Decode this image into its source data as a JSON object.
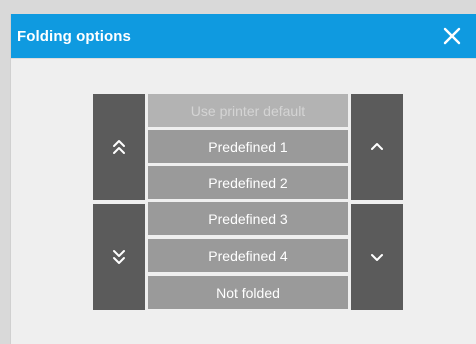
{
  "dialog": {
    "title": "Folding options",
    "close_icon": "close-icon"
  },
  "options": [
    {
      "label": "Use printer default",
      "state": "disabled"
    },
    {
      "label": "Predefined 1",
      "state": "enabled"
    },
    {
      "label": "Predefined 2",
      "state": "enabled"
    },
    {
      "label": "Predefined 3",
      "state": "enabled"
    },
    {
      "label": "Predefined 4",
      "state": "enabled"
    },
    {
      "label": "Not folded",
      "state": "enabled"
    }
  ],
  "controls": {
    "first_icon": "double-chevron-up-icon",
    "last_icon": "double-chevron-down-icon",
    "previous_icon": "chevron-up-icon",
    "next_icon": "chevron-down-icon"
  },
  "colors": {
    "titlebar": "#0f9ae0",
    "control": "#5b5b5b",
    "option": "#9a9a9a",
    "option_disabled": "#b3b3b3"
  }
}
